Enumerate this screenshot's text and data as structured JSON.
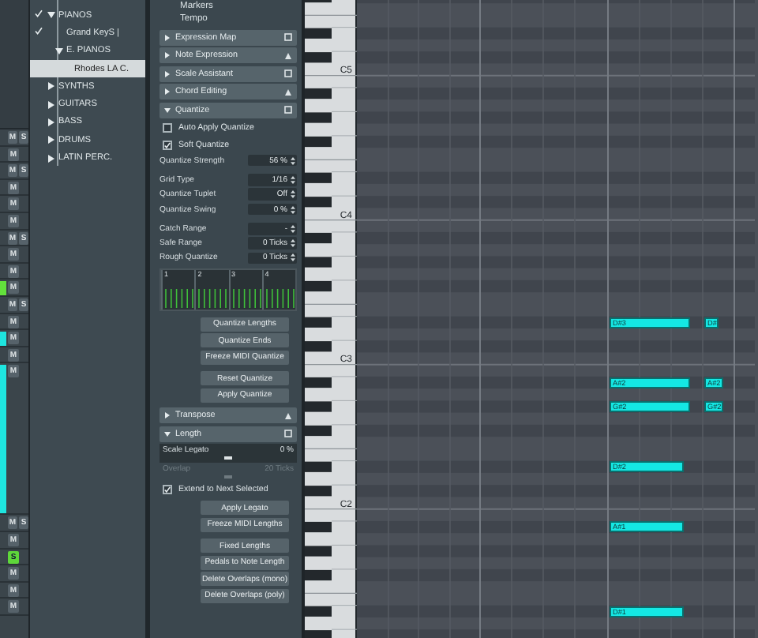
{
  "track_strip": [
    {
      "kind": "track",
      "buttons": [
        {
          "label": "M",
          "on": false
        },
        {
          "label": "S",
          "on": false
        }
      ]
    },
    {
      "kind": "track",
      "buttons": [
        {
          "label": "M",
          "on": false
        }
      ]
    },
    {
      "kind": "track",
      "buttons": [
        {
          "label": "M",
          "on": false
        },
        {
          "label": "S",
          "on": false
        }
      ]
    },
    {
      "kind": "track",
      "buttons": [
        {
          "label": "M",
          "on": false
        }
      ]
    },
    {
      "kind": "track",
      "buttons": [
        {
          "label": "M",
          "on": false
        }
      ]
    },
    {
      "kind": "track",
      "buttons": [
        {
          "label": "M",
          "on": false
        }
      ]
    },
    {
      "kind": "track",
      "buttons": [
        {
          "label": "M",
          "on": false
        },
        {
          "label": "S",
          "on": false
        }
      ]
    },
    {
      "kind": "track",
      "buttons": [
        {
          "label": "M",
          "on": false
        }
      ]
    },
    {
      "kind": "track",
      "buttons": [
        {
          "label": "M",
          "on": false
        }
      ]
    },
    {
      "kind": "track",
      "color": "#63e23c",
      "buttons": [
        {
          "label": "M",
          "on": false
        }
      ]
    },
    {
      "kind": "track",
      "buttons": [
        {
          "label": "M",
          "on": false
        },
        {
          "label": "S",
          "on": false
        }
      ]
    },
    {
      "kind": "track",
      "buttons": [
        {
          "label": "M",
          "on": false
        }
      ]
    },
    {
      "kind": "track",
      "color": "#1ee6e0",
      "buttons": [
        {
          "label": "M",
          "on": false
        }
      ]
    },
    {
      "kind": "track",
      "buttons": [
        {
          "label": "M",
          "on": false
        }
      ]
    },
    {
      "kind": "lane",
      "color": "#1ee6e0",
      "buttons": [
        {
          "label": "M",
          "on": false
        }
      ]
    },
    {
      "kind": "track",
      "buttons": [
        {
          "label": "M",
          "on": false
        },
        {
          "label": "S",
          "on": false
        }
      ]
    },
    {
      "kind": "track",
      "buttons": [
        {
          "label": "M",
          "on": false
        }
      ]
    },
    {
      "kind": "track",
      "buttons": [
        {
          "label": "S",
          "on": true
        }
      ]
    },
    {
      "kind": "track",
      "buttons": [
        {
          "label": "M",
          "on": false
        }
      ]
    },
    {
      "kind": "track",
      "buttons": [
        {
          "label": "M",
          "on": false
        }
      ]
    },
    {
      "kind": "track",
      "buttons": [
        {
          "label": "M",
          "on": false
        }
      ]
    }
  ],
  "media_tree": [
    {
      "label": "PIANOS",
      "checked": true,
      "expanded": true,
      "selected": false,
      "children": [
        {
          "label": "Grand KeyS |",
          "checked": true,
          "selected": false
        },
        {
          "label": "E. PIANOS",
          "checked": false,
          "expanded": true,
          "selected": false,
          "children": [
            {
              "label": "Rhodes LA C.",
              "checked": false,
              "selected": true
            }
          ]
        }
      ]
    },
    {
      "label": "SYNTHS",
      "checked": false,
      "expanded": false,
      "selected": false
    },
    {
      "label": "GUITARS",
      "checked": false,
      "expanded": false,
      "selected": false
    },
    {
      "label": "BASS",
      "checked": false,
      "expanded": false,
      "selected": false
    },
    {
      "label": "DRUMS",
      "checked": false,
      "expanded": false,
      "selected": false
    },
    {
      "label": "LATIN PERC.",
      "checked": false,
      "expanded": false,
      "selected": false
    }
  ],
  "inspector": {
    "items_above": [
      "Markers",
      "Tempo"
    ],
    "sections": [
      {
        "title": "Expression Map",
        "expanded": false
      },
      {
        "title": "Note Expression",
        "expanded": false
      },
      {
        "title": "Scale Assistant",
        "expanded": false
      },
      {
        "title": "Chord Editing",
        "expanded": false
      },
      {
        "title": "Quantize",
        "expanded": true,
        "controls": [
          {
            "kind": "checkbox",
            "label": "Auto Apply Quantize",
            "checked": false
          },
          {
            "kind": "checkbox",
            "label": "Soft Quantize",
            "checked": true
          },
          {
            "kind": "spin",
            "label": "Quantize Strength",
            "value": "56 %"
          },
          {
            "kind": "gap"
          },
          {
            "kind": "spin",
            "label": "Grid Type",
            "value": "1/16"
          },
          {
            "kind": "spin",
            "label": "Quantize Tuplet",
            "value": "Off"
          },
          {
            "kind": "spin",
            "label": "Quantize Swing",
            "value": "0 %"
          },
          {
            "kind": "gap"
          },
          {
            "kind": "spin",
            "label": "Catch Range",
            "value": "-"
          },
          {
            "kind": "spin",
            "label": "Safe Range",
            "value": "0 Ticks"
          },
          {
            "kind": "spin",
            "label": "Rough Quantize",
            "value": "0 Ticks"
          },
          {
            "kind": "grid",
            "labels": [
              "1",
              "2",
              "3",
              "4"
            ]
          },
          {
            "kind": "button",
            "label": "Quantize Lengths"
          },
          {
            "kind": "button",
            "label": "Quantize Ends"
          },
          {
            "kind": "button",
            "label": "Freeze MIDI Quantize"
          },
          {
            "kind": "gap"
          },
          {
            "kind": "button",
            "label": "Reset Quantize"
          },
          {
            "kind": "button",
            "label": "Apply Quantize"
          }
        ]
      },
      {
        "title": "Transpose",
        "expanded": false
      },
      {
        "title": "Length",
        "expanded": true,
        "controls": [
          {
            "kind": "slider",
            "label": "Scale Legato",
            "value": "0 %",
            "level": 0.5,
            "disabled": false
          },
          {
            "kind": "slider",
            "label": "Overlap",
            "value": "20 Ticks",
            "level": 0.5,
            "disabled": true
          },
          {
            "kind": "checkbox",
            "label": "Extend to Next Selected",
            "checked": true
          },
          {
            "kind": "button",
            "label": "Apply Legato"
          },
          {
            "kind": "button",
            "label": "Freeze MIDI Lengths"
          },
          {
            "kind": "gap"
          },
          {
            "kind": "button",
            "label": "Fixed Lengths"
          },
          {
            "kind": "button",
            "label": "Pedals to Note Length"
          },
          {
            "kind": "button",
            "label": "Delete Overlaps (mono)"
          },
          {
            "kind": "button",
            "label": "Delete Overlaps (poly)"
          }
        ]
      }
    ]
  },
  "keyboard": {
    "octave_labels": [
      "C5",
      "C4",
      "C3",
      "C2"
    ]
  },
  "notes": [
    {
      "label": "D#3",
      "kind": "long"
    },
    {
      "label": "D#",
      "kind": "short"
    },
    {
      "label": "A#2",
      "kind": "long"
    },
    {
      "label": "A#2",
      "kind": "short"
    },
    {
      "label": "G#2",
      "kind": "long"
    },
    {
      "label": "G#2",
      "kind": "short"
    },
    {
      "label": "D#2",
      "kind": "long"
    },
    {
      "label": "A#1",
      "kind": "long"
    },
    {
      "label": "D#1",
      "kind": "long"
    }
  ]
}
